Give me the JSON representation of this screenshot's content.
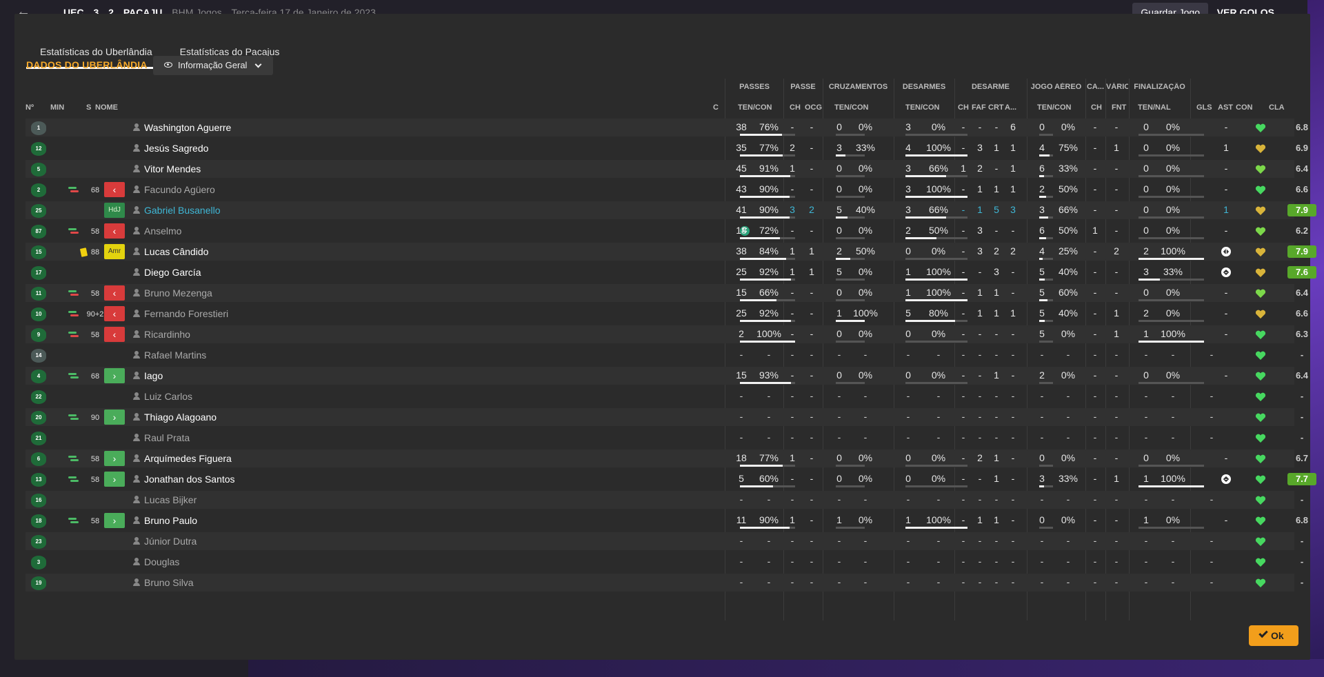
{
  "topbar": {
    "score": [
      "UEC",
      "3",
      "2",
      "PACAJU"
    ],
    "competition": "BHM Jogos",
    "date": "Terça-feira 17 de Janeiro de 2023",
    "save_label": "Guardar Jogo",
    "goals_label": "VER GOLOS"
  },
  "tabs": [
    {
      "label": "Estatísticas do Uberlândia",
      "active": true
    },
    {
      "label": "Estatísticas do Pacajus",
      "active": false
    }
  ],
  "section_title": "DADOS DO UBERLÂNDIA",
  "view_select": "Informação Geral",
  "group_headers": [
    "PASSES",
    "PASSE",
    "CRUZAMENTOS",
    "DESARMES",
    "DESARME",
    "JOGO AÉREO",
    "CA...",
    "VÁRIOS",
    "FINALIZAÇÃO"
  ],
  "column_headers": {
    "no": "Nº",
    "min": "MIN",
    "s": "S",
    "name": "NOME",
    "c": "C",
    "passes": "TEN/CON",
    "passe_ch": "CH",
    "passe_ocg": "OCG",
    "cross": "TEN/CON",
    "tackles": "TEN/CON",
    "desarme_ch": "CH",
    "desarme_faf": "FAF",
    "desarme_crt": "CRT",
    "desarme_a": "A...",
    "aerial": "TEN/CON",
    "ca_ch": "CH",
    "varios_fnt": "FNT",
    "fin": "TEN/NAL",
    "gls": "GLS",
    "ast": "AST",
    "con": "CON",
    "cla": "CLA"
  },
  "colors": {
    "accent": "#f6a92a",
    "out": "#d83b3b",
    "in": "#4aac5a",
    "rating_good": "#58a82a",
    "cyan": "#3fb7d6"
  },
  "players": [
    {
      "no": "1",
      "gk": true,
      "name": "Washington Aguerre",
      "p": [
        "38",
        "76%"
      ],
      "pc": [
        "-",
        "-"
      ],
      "cr": [
        "0",
        "0%"
      ],
      "ds": [
        "3",
        "0%"
      ],
      "dsx": [
        "-",
        "-",
        "-",
        "6"
      ],
      "ae": [
        "0",
        "0%"
      ],
      "ca": "-",
      "fnt": "-",
      "fin": [
        "0",
        "0%"
      ],
      "gls": "",
      "ast": "-",
      "heart": "green",
      "cla": "6.8",
      "rate": 0.76,
      "crr": 0,
      "dsr": 0,
      "aer": 0,
      "finr": 0
    },
    {
      "no": "12",
      "name": "Jesús Sagredo",
      "p": [
        "35",
        "77%"
      ],
      "pc": [
        "2",
        "-"
      ],
      "cr": [
        "3",
        "33%"
      ],
      "ds": [
        "4",
        "100%"
      ],
      "dsx": [
        "-",
        "3",
        "1",
        "1"
      ],
      "ae": [
        "4",
        "75%"
      ],
      "ca": "-",
      "fnt": "1",
      "fin": [
        "0",
        "0%"
      ],
      "gls": "",
      "ast": "1",
      "heart": "yellow",
      "cla": "6.9",
      "rate": 0.77,
      "crr": 0.33,
      "dsr": 1,
      "aer": 0.75,
      "finr": 0
    },
    {
      "no": "5",
      "name": "Vitor Mendes",
      "p": [
        "45",
        "91%"
      ],
      "pc": [
        "1",
        "-"
      ],
      "cr": [
        "0",
        "0%"
      ],
      "ds": [
        "3",
        "66%"
      ],
      "dsx": [
        "1",
        "2",
        "-",
        "1"
      ],
      "ae": [
        "6",
        "33%"
      ],
      "ca": "-",
      "fnt": "-",
      "fin": [
        "0",
        "0%"
      ],
      "gls": "",
      "ast": "-",
      "heart": "lime",
      "cla": "6.4",
      "rate": 0.91,
      "crr": 0,
      "dsr": 0.66,
      "aer": 0.33,
      "finr": 0
    },
    {
      "no": "2",
      "name": "Facundo Agüero",
      "dim": true,
      "sub": "out",
      "min": "68",
      "p": [
        "43",
        "90%"
      ],
      "pc": [
        "-",
        "-"
      ],
      "cr": [
        "0",
        "0%"
      ],
      "ds": [
        "3",
        "100%"
      ],
      "dsx": [
        "-",
        "1",
        "1",
        "1"
      ],
      "ae": [
        "2",
        "50%"
      ],
      "ca": "-",
      "fnt": "-",
      "fin": [
        "0",
        "0%"
      ],
      "gls": "",
      "ast": "-",
      "heart": "green",
      "cla": "6.6",
      "rate": 0.9,
      "crr": 0,
      "dsr": 1,
      "aer": 0.5,
      "finr": 0
    },
    {
      "no": "25",
      "name": "Gabriel Busanello",
      "hl": true,
      "badge": "HdJ",
      "p": [
        "41",
        "90%"
      ],
      "pc": [
        "3",
        "2"
      ],
      "cr": [
        "5",
        "40%"
      ],
      "ds": [
        "3",
        "66%"
      ],
      "dsx": [
        "-",
        "1",
        "5",
        "3"
      ],
      "ae": [
        "3",
        "66%"
      ],
      "ca": "-",
      "fnt": "-",
      "fin": [
        "0",
        "0%"
      ],
      "gls": "",
      "ast": "1",
      "heart": "yellow",
      "cla": "7.9",
      "good": true,
      "cyan": true,
      "rate": 0.9,
      "crr": 0.4,
      "dsr": 0.66,
      "aer": 0.66,
      "finr": 0
    },
    {
      "no": "87",
      "name": "Anselmo",
      "dim": true,
      "sub": "out",
      "min": "58",
      "cap": true,
      "p": [
        "18",
        "72%"
      ],
      "pc": [
        "-",
        "-"
      ],
      "cr": [
        "0",
        "0%"
      ],
      "ds": [
        "2",
        "50%"
      ],
      "dsx": [
        "-",
        "3",
        "-",
        "-"
      ],
      "ae": [
        "6",
        "50%"
      ],
      "ca": "1",
      "fnt": "-",
      "fin": [
        "0",
        "0%"
      ],
      "gls": "",
      "ast": "-",
      "heart": "lime",
      "cla": "6.2",
      "rate": 0.72,
      "crr": 0,
      "dsr": 0.5,
      "aer": 0.5,
      "finr": 0
    },
    {
      "no": "15",
      "name": "Lucas Cândido",
      "yellow": true,
      "badge": "Amr",
      "min": "88",
      "p": [
        "38",
        "84%"
      ],
      "pc": [
        "1",
        "1"
      ],
      "cr": [
        "2",
        "50%"
      ],
      "ds": [
        "0",
        "0%"
      ],
      "dsx": [
        "-",
        "3",
        "2",
        "2"
      ],
      "ae": [
        "4",
        "25%"
      ],
      "ca": "-",
      "fnt": "2",
      "fin": [
        "2",
        "100%"
      ],
      "gls": "ball",
      "ast": "1",
      "heart": "yellow",
      "cla": "7.9",
      "good": true,
      "rate": 0.84,
      "crr": 0.5,
      "dsr": 0,
      "aer": 0.25,
      "finr": 1
    },
    {
      "no": "17",
      "name": "Diego García",
      "p": [
        "25",
        "92%"
      ],
      "pc": [
        "1",
        "1"
      ],
      "cr": [
        "5",
        "0%"
      ],
      "ds": [
        "1",
        "100%"
      ],
      "dsx": [
        "-",
        "-",
        "3",
        "-"
      ],
      "ae": [
        "5",
        "40%"
      ],
      "ca": "-",
      "fnt": "-",
      "fin": [
        "3",
        "33%"
      ],
      "gls": "ball",
      "ast": "-",
      "heart": "yellow",
      "cla": "7.6",
      "good": true,
      "rate": 0.92,
      "crr": 0,
      "dsr": 1,
      "aer": 0.4,
      "finr": 0.33
    },
    {
      "no": "11",
      "name": "Bruno Mezenga",
      "dim": true,
      "sub": "out",
      "min": "58",
      "p": [
        "15",
        "66%"
      ],
      "pc": [
        "-",
        "-"
      ],
      "cr": [
        "0",
        "0%"
      ],
      "ds": [
        "1",
        "100%"
      ],
      "dsx": [
        "-",
        "1",
        "1",
        "-"
      ],
      "ae": [
        "5",
        "60%"
      ],
      "ca": "-",
      "fnt": "-",
      "fin": [
        "0",
        "0%"
      ],
      "gls": "",
      "ast": "-",
      "heart": "lime",
      "cla": "6.4",
      "rate": 0.66,
      "crr": 0,
      "dsr": 1,
      "aer": 0.6,
      "finr": 0
    },
    {
      "no": "10",
      "name": "Fernando Forestieri",
      "dim": true,
      "sub": "out",
      "min": "90+2",
      "p": [
        "25",
        "92%"
      ],
      "pc": [
        "-",
        "-"
      ],
      "cr": [
        "1",
        "100%"
      ],
      "ds": [
        "5",
        "80%"
      ],
      "dsx": [
        "-",
        "1",
        "1",
        "1"
      ],
      "ae": [
        "5",
        "40%"
      ],
      "ca": "-",
      "fnt": "1",
      "fin": [
        "2",
        "0%"
      ],
      "gls": "",
      "ast": "-",
      "heart": "yellow",
      "cla": "6.6",
      "rate": 0.92,
      "crr": 1,
      "dsr": 0.8,
      "aer": 0.4,
      "finr": 0
    },
    {
      "no": "9",
      "name": "Ricardinho",
      "dim": true,
      "sub": "out",
      "min": "58",
      "p": [
        "2",
        "100%"
      ],
      "pc": [
        "-",
        "-"
      ],
      "cr": [
        "0",
        "0%"
      ],
      "ds": [
        "0",
        "0%"
      ],
      "dsx": [
        "-",
        "-",
        "-",
        "-"
      ],
      "ae": [
        "5",
        "0%"
      ],
      "ca": "-",
      "fnt": "1",
      "fin": [
        "1",
        "100%"
      ],
      "gls": "",
      "ast": "-",
      "heart": "green",
      "cla": "6.3",
      "rate": 1,
      "crr": 0,
      "dsr": 0,
      "aer": 0,
      "finr": 1
    },
    {
      "no": "14",
      "gk": true,
      "name": "Rafael Martins",
      "dim": true,
      "empty": true,
      "heart": "green",
      "cla": "-"
    },
    {
      "no": "4",
      "name": "Iago",
      "sub": "in",
      "min": "68",
      "p": [
        "15",
        "93%"
      ],
      "pc": [
        "-",
        "-"
      ],
      "cr": [
        "0",
        "0%"
      ],
      "ds": [
        "0",
        "0%"
      ],
      "dsx": [
        "-",
        "-",
        "1",
        "-"
      ],
      "ae": [
        "2",
        "0%"
      ],
      "ca": "-",
      "fnt": "-",
      "fin": [
        "0",
        "0%"
      ],
      "gls": "",
      "ast": "-",
      "heart": "green",
      "cla": "6.4",
      "rate": 0.93,
      "crr": 0,
      "dsr": 0,
      "aer": 0,
      "finr": 0
    },
    {
      "no": "22",
      "name": "Luiz Carlos",
      "dim": true,
      "empty": true,
      "heart": "green",
      "cla": "-"
    },
    {
      "no": "20",
      "name": "Thiago Alagoano",
      "sub": "in",
      "min": "90",
      "empty": true,
      "heart": "green",
      "cla": "-"
    },
    {
      "no": "21",
      "name": "Raul Prata",
      "dim": true,
      "empty": true,
      "heart": "green",
      "cla": "-"
    },
    {
      "no": "6",
      "name": "Arquímedes Figuera",
      "sub": "in",
      "min": "58",
      "p": [
        "18",
        "77%"
      ],
      "pc": [
        "1",
        "-"
      ],
      "cr": [
        "0",
        "0%"
      ],
      "ds": [
        "0",
        "0%"
      ],
      "dsx": [
        "-",
        "2",
        "1",
        "-"
      ],
      "ae": [
        "0",
        "0%"
      ],
      "ca": "-",
      "fnt": "-",
      "fin": [
        "0",
        "0%"
      ],
      "gls": "",
      "ast": "-",
      "heart": "green",
      "cla": "6.7",
      "rate": 0.77,
      "crr": 0,
      "dsr": 0,
      "aer": 0,
      "finr": 0
    },
    {
      "no": "13",
      "name": "Jonathan dos Santos",
      "sub": "in",
      "min": "58",
      "p": [
        "5",
        "60%"
      ],
      "pc": [
        "-",
        "-"
      ],
      "cr": [
        "0",
        "0%"
      ],
      "ds": [
        "0",
        "0%"
      ],
      "dsx": [
        "-",
        "-",
        "1",
        "-"
      ],
      "ae": [
        "3",
        "33%"
      ],
      "ca": "-",
      "fnt": "1",
      "fin": [
        "1",
        "100%"
      ],
      "gls": "ball",
      "ast": "-",
      "heart": "green",
      "cla": "7.7",
      "good": true,
      "rate": 0.6,
      "crr": 0,
      "dsr": 0,
      "aer": 0.33,
      "finr": 1
    },
    {
      "no": "16",
      "name": "Lucas Bijker",
      "dim": true,
      "empty": true,
      "heart": "green",
      "cla": "-"
    },
    {
      "no": "18",
      "name": "Bruno Paulo",
      "sub": "in",
      "min": "58",
      "p": [
        "11",
        "90%"
      ],
      "pc": [
        "1",
        "-"
      ],
      "cr": [
        "1",
        "0%"
      ],
      "ds": [
        "1",
        "100%"
      ],
      "dsx": [
        "-",
        "1",
        "1",
        "-"
      ],
      "ae": [
        "0",
        "0%"
      ],
      "ca": "-",
      "fnt": "-",
      "fin": [
        "1",
        "0%"
      ],
      "gls": "",
      "ast": "-",
      "heart": "green",
      "cla": "6.8",
      "rate": 0.9,
      "crr": 0,
      "dsr": 1,
      "aer": 0,
      "finr": 0
    },
    {
      "no": "23",
      "name": "Júnior Dutra",
      "dim": true,
      "empty": true,
      "heart": "green",
      "cla": "-"
    },
    {
      "no": "3",
      "name": "Douglas",
      "dim": true,
      "empty": true,
      "heart": "green",
      "cla": "-"
    },
    {
      "no": "19",
      "name": "Bruno Silva",
      "dim": true,
      "empty": true,
      "heart": "green",
      "cla": "-"
    }
  ],
  "ok_label": "Ok"
}
